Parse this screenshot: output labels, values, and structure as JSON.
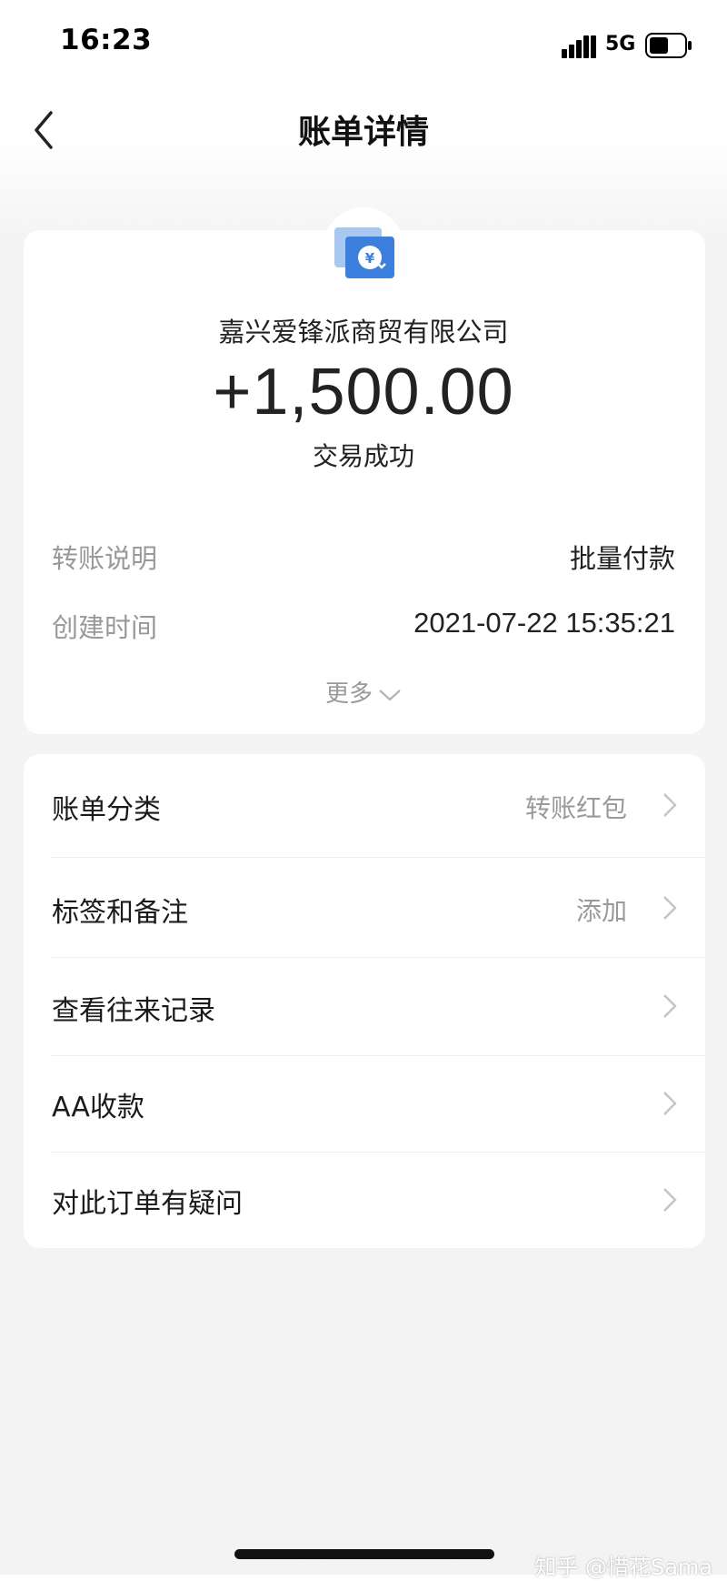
{
  "status_bar": {
    "time": "16:23",
    "network": "5G",
    "icons": [
      "signal-icon",
      "battery-icon"
    ]
  },
  "nav": {
    "title": "账单详情",
    "back_icon": "chevron-left-icon"
  },
  "summary": {
    "icon": "transfer-icon",
    "payer": "嘉兴爱锋派商贸有限公司",
    "amount": "+1,500.00",
    "status": "交易成功",
    "details": [
      {
        "label": "转账说明",
        "value": "批量付款"
      },
      {
        "label": "创建时间",
        "value": "2021-07-22 15:35:21"
      }
    ],
    "more_label": "更多"
  },
  "menu": [
    {
      "label": "账单分类",
      "value": "转账红包"
    },
    {
      "label": "标签和备注",
      "value": "添加"
    },
    {
      "label": "查看往来记录",
      "value": ""
    },
    {
      "label": "AA收款",
      "value": ""
    },
    {
      "label": "对此订单有疑问",
      "value": ""
    }
  ],
  "watermark": "知乎 @惜花Sama",
  "colors": {
    "accent_blue": "#3d7fdc",
    "label_gray": "#999999",
    "background": "#f3f3f3"
  }
}
